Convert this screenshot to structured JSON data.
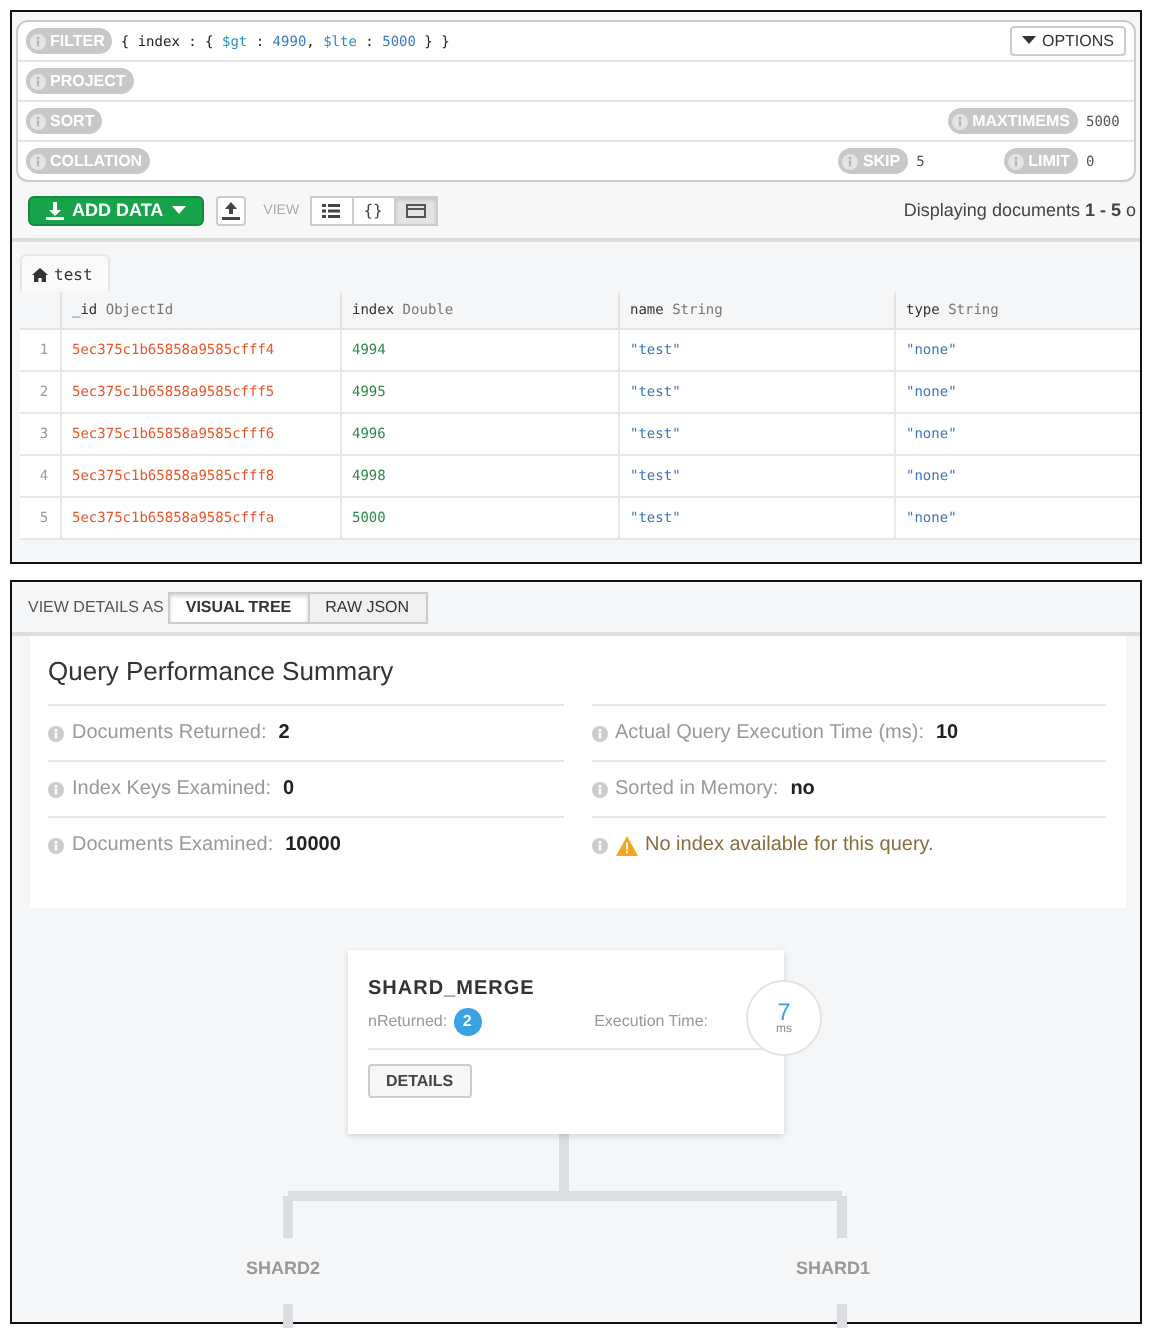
{
  "query_bar": {
    "filter": {
      "label": "FILTER",
      "tokens": [
        {
          "text": "{ index : { ",
          "kind": "plain"
        },
        {
          "text": "$gt",
          "kind": "operator"
        },
        {
          "text": " : ",
          "kind": "plain"
        },
        {
          "text": "4990",
          "kind": "number"
        },
        {
          "text": ", ",
          "kind": "plain"
        },
        {
          "text": "$lte",
          "kind": "operator"
        },
        {
          "text": " : ",
          "kind": "plain"
        },
        {
          "text": "5000",
          "kind": "number"
        },
        {
          "text": " } }",
          "kind": "plain"
        }
      ]
    },
    "options_button": "OPTIONS",
    "project": {
      "label": "PROJECT"
    },
    "sort": {
      "label": "SORT"
    },
    "maxtimems": {
      "label": "MAXTIMEMS",
      "value": "5000"
    },
    "collation": {
      "label": "COLLATION"
    },
    "skip": {
      "label": "SKIP",
      "value": "5"
    },
    "limit": {
      "label": "LIMIT",
      "value": "0"
    }
  },
  "toolbar": {
    "add_data": "ADD DATA",
    "view_label": "VIEW",
    "view_buttons": [
      {
        "kind": "list",
        "selected": false
      },
      {
        "kind": "json",
        "label": "{}",
        "selected": false
      },
      {
        "kind": "table",
        "selected": true
      }
    ],
    "status": "Displaying documents **1 - 5** o"
  },
  "collection_tab": "test",
  "table": {
    "columns": [
      {
        "name": "_id",
        "type": "ObjectId",
        "kind": "objectid"
      },
      {
        "name": "index",
        "type": "Double",
        "kind": "number"
      },
      {
        "name": "name",
        "type": "String",
        "kind": "string"
      },
      {
        "name": "type",
        "type": "String",
        "kind": "string"
      }
    ],
    "rows": [
      {
        "number": "1",
        "cells": [
          "5ec375c1b65858a9585cfff4",
          "4994",
          "\"test\"",
          "\"none\""
        ]
      },
      {
        "number": "2",
        "cells": [
          "5ec375c1b65858a9585cfff5",
          "4995",
          "\"test\"",
          "\"none\""
        ]
      },
      {
        "number": "3",
        "cells": [
          "5ec375c1b65858a9585cfff6",
          "4996",
          "\"test\"",
          "\"none\""
        ]
      },
      {
        "number": "4",
        "cells": [
          "5ec375c1b65858a9585cfff8",
          "4998",
          "\"test\"",
          "\"none\""
        ]
      },
      {
        "number": "5",
        "cells": [
          "5ec375c1b65858a9585cfffa",
          "5000",
          "\"test\"",
          "\"none\""
        ]
      }
    ]
  },
  "view_details": {
    "label": "VIEW DETAILS AS",
    "tabs": [
      {
        "label": "VISUAL TREE",
        "selected": true
      },
      {
        "label": "RAW JSON",
        "selected": false
      }
    ]
  },
  "summary": {
    "title": "Query Performance Summary",
    "left": [
      {
        "kind": "metric",
        "label": "Documents Returned:",
        "value": "2"
      },
      {
        "kind": "metric",
        "label": "Index Keys Examined:",
        "value": "0"
      },
      {
        "kind": "metric",
        "label": "Documents Examined:",
        "value": "10000"
      }
    ],
    "right": [
      {
        "kind": "metric",
        "label": "Actual Query Execution Time (ms):",
        "value": "10"
      },
      {
        "kind": "metric",
        "label": "Sorted in Memory:",
        "value": "no"
      },
      {
        "kind": "warning",
        "label": "No index available for this query."
      }
    ]
  },
  "tree": {
    "root": {
      "name": "SHARD_MERGE",
      "returned_label": "nReturned:",
      "returned": "2",
      "time_label": "Execution Time:",
      "time": "7",
      "time_unit": "ms",
      "button": "DETAILS"
    },
    "children": [
      {
        "name": "SHARD2"
      },
      {
        "name": "SHARD1"
      }
    ]
  }
}
